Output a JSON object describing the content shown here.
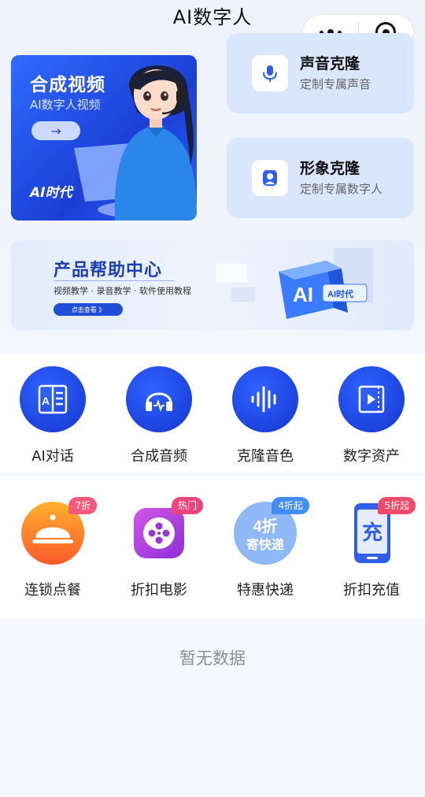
{
  "nav": {
    "title": "AI数字人"
  },
  "video_card": {
    "title": "合成视频",
    "subtitle": "AI数字人视频",
    "arrow": "→",
    "logo": "AI时代"
  },
  "clone_cards": [
    {
      "title": "声音克隆",
      "subtitle": "定制专属声音",
      "icon": "microphone-icon"
    },
    {
      "title": "形象克隆",
      "subtitle": "定制专属数字人",
      "icon": "portrait-icon"
    }
  ],
  "help_banner": {
    "title": "产品帮助中心",
    "subtitle": "视频教学 · 录音教学 · 软件使用教程",
    "button": "点击查看 》",
    "art_label": "AI",
    "art_tag": "AI时代"
  },
  "tools": [
    {
      "label": "AI对话",
      "icon": "ai-chat-icon"
    },
    {
      "label": "合成音频",
      "icon": "headphones-icon"
    },
    {
      "label": "克隆音色",
      "icon": "soundwave-icon"
    },
    {
      "label": "数字资产",
      "icon": "video-asset-icon"
    }
  ],
  "services": [
    {
      "label": "连锁点餐",
      "badge": "7折",
      "badge_color": "#f25b7a",
      "icon": "food-cloche-icon"
    },
    {
      "label": "折扣电影",
      "badge": "热门",
      "badge_color": "#f0457c",
      "icon": "film-reel-icon"
    },
    {
      "label": "特惠快递",
      "badge": "4折起",
      "badge_color": "#3f8ef5",
      "icon": "express-delivery-icon",
      "icon_text_1": "4折",
      "icon_text_2": "寄快递"
    },
    {
      "label": "折扣充值",
      "badge": "5折起",
      "badge_color": "#f04a6b",
      "icon": "phone-recharge-icon",
      "icon_text": "充"
    }
  ],
  "empty": {
    "text": "暂无数据"
  },
  "colors": {
    "primary": "#1f4fd8",
    "card_bg": "#d9e6fb"
  }
}
